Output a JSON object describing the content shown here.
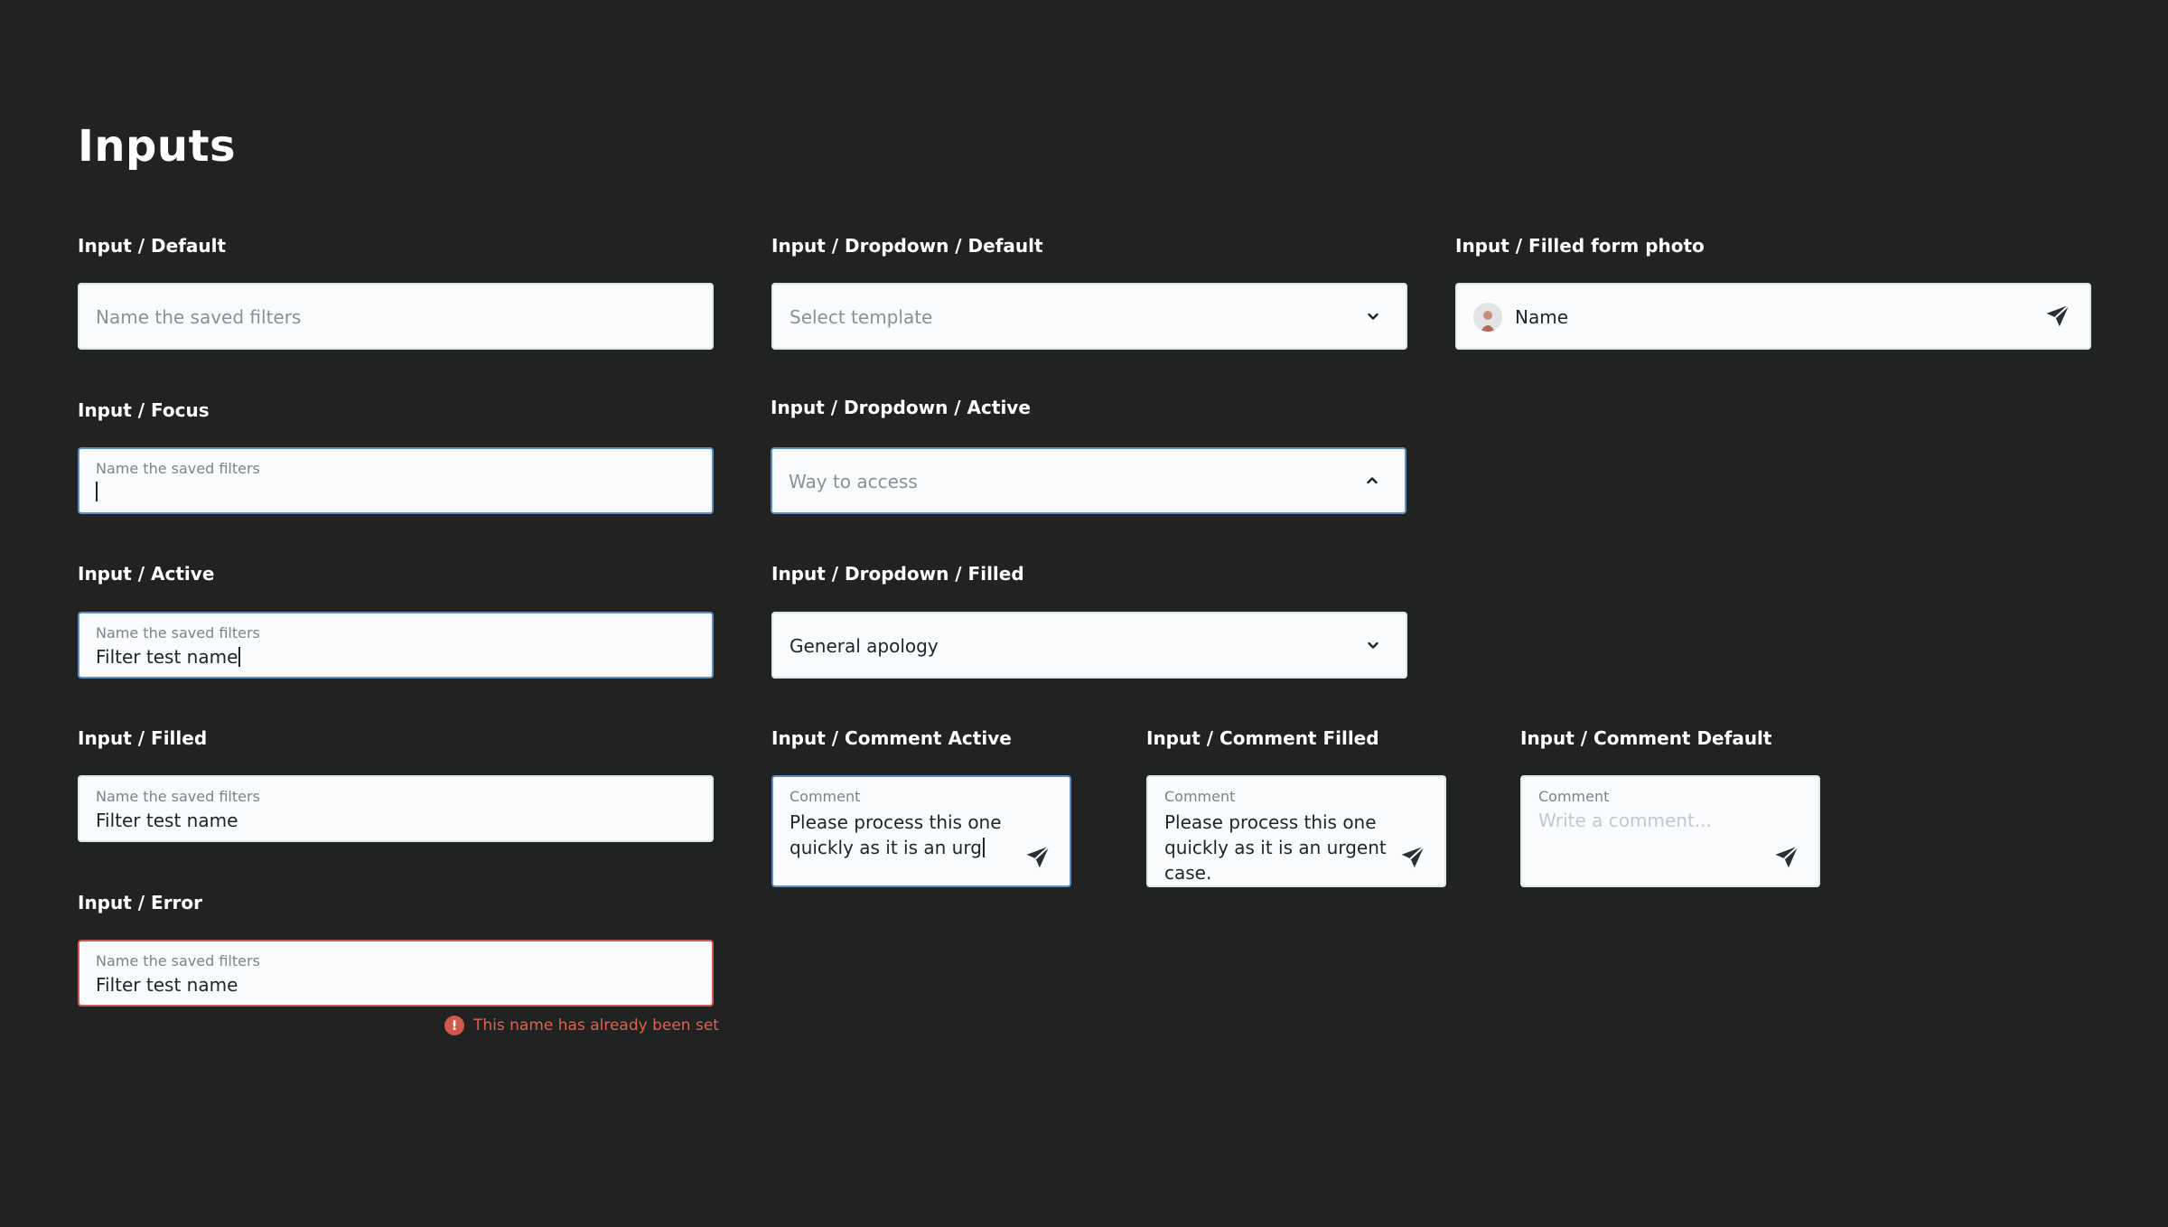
{
  "page": {
    "title": "Inputs"
  },
  "colors": {
    "background": "#212322",
    "field_bg": "#fafbfc",
    "focus_border": "#5b8fbf",
    "error": "#d0584c",
    "text": "#1e2428",
    "muted": "#8b9096"
  },
  "input_default": {
    "label": "Input / Default",
    "placeholder": "Name the saved filters"
  },
  "input_focus": {
    "label": "Input / Focus",
    "float_label": "Name the saved filters",
    "value": ""
  },
  "input_active": {
    "label": "Input / Active",
    "float_label": "Name the saved filters",
    "value": "Filter test name"
  },
  "input_filled": {
    "label": "Input / Filled",
    "float_label": "Name the saved filters",
    "value": "Filter test name"
  },
  "input_error": {
    "label": "Input / Error",
    "float_label": "Name the saved filters",
    "value": "Filter test name",
    "error_message": "This name has already been set",
    "error_icon": "alert-circle-icon"
  },
  "dropdown_default": {
    "label": "Input / Dropdown / Default",
    "placeholder": "Select template",
    "icon": "chevron-down-icon"
  },
  "dropdown_active": {
    "label": "Input / Dropdown / Active",
    "placeholder": "Way to access",
    "icon": "chevron-up-icon"
  },
  "dropdown_filled": {
    "label": "Input / Dropdown / Filled",
    "value": "General apology",
    "icon": "chevron-down-icon"
  },
  "filled_form_photo": {
    "label": "Input / Filled form photo",
    "name": "Name",
    "avatar_icon": "avatar",
    "send_icon": "send-icon"
  },
  "comment_active": {
    "label": "Input / Comment Active",
    "float_label": "Comment",
    "value": "Please process this one quickly as it is an urg",
    "send_icon": "send-icon"
  },
  "comment_filled": {
    "label": "Input / Comment Filled",
    "float_label": "Comment",
    "value": "Please process this one quickly as it is an urgent case.",
    "send_icon": "send-icon"
  },
  "comment_default": {
    "label": "Input / Comment Default",
    "float_label": "Comment",
    "placeholder": "Write a comment...",
    "send_icon": "send-icon"
  }
}
